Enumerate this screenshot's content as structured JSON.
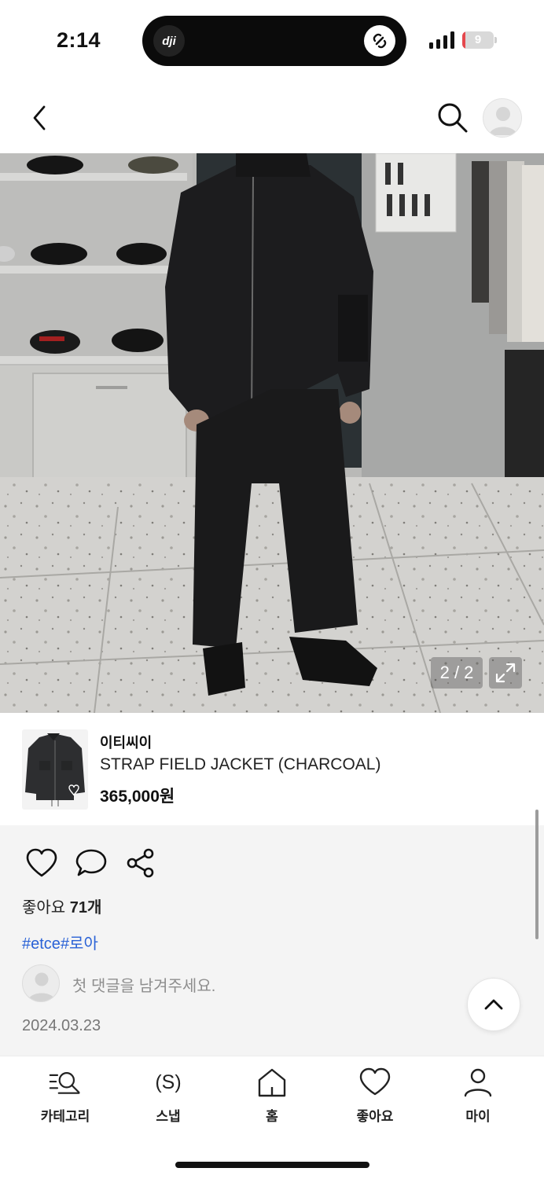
{
  "status_bar": {
    "time": "2:14",
    "island_logo": "dji",
    "battery_level": "9",
    "battery_fraction": 0.09,
    "icons": [
      "signal-icon",
      "battery-icon",
      "link-icon"
    ]
  },
  "top_nav": {
    "icons": [
      "back-chevron-icon",
      "search-icon",
      "profile-avatar-icon"
    ]
  },
  "photo": {
    "counter": "2 / 2",
    "current": 2,
    "total": 2,
    "icons": [
      "expand-icon"
    ]
  },
  "product": {
    "brand": "이티씨이",
    "name": "STRAP FIELD JACKET (CHARCOAL)",
    "price": "365,000원"
  },
  "social": {
    "likes_label": "좋아요",
    "likes_count": "71개",
    "hashtags": [
      "#etce",
      "#로아"
    ],
    "comment_placeholder": "첫 댓글을 남겨주세요.",
    "date": "2024.03.23",
    "icons": [
      "heart-icon",
      "comment-icon",
      "share-icon",
      "chevron-up-icon"
    ]
  },
  "tab_bar": {
    "tabs": [
      {
        "label": "카테고리",
        "icon": "category-search-icon"
      },
      {
        "label": "스냅",
        "icon": "snap-icon"
      },
      {
        "label": "홈",
        "icon": "home-icon"
      },
      {
        "label": "좋아요",
        "icon": "heart-icon"
      },
      {
        "label": "마이",
        "icon": "person-icon"
      }
    ]
  },
  "colors": {
    "hashtag": "#2a62d6",
    "battery_low": "#e5484d",
    "social_bg": "#f4f4f4"
  }
}
